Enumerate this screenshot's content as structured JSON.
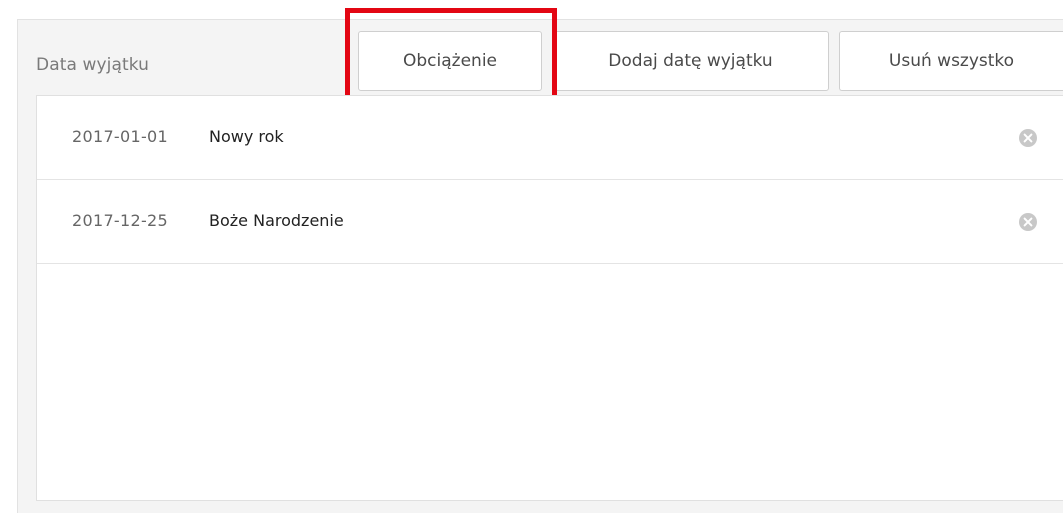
{
  "section": {
    "label": "Data wyjątku"
  },
  "toolbar": {
    "load_label": "Obciążenie",
    "add_label": "Dodaj datę wyjątku",
    "delete_all_label": "Usuń wszystko"
  },
  "exceptions": [
    {
      "date": "2017-01-01",
      "name": "Nowy rok",
      "remove_icon": "remove-circle-icon"
    },
    {
      "date": "2017-12-25",
      "name": "Boże Narodzenie",
      "remove_icon": "remove-circle-icon"
    }
  ],
  "colors": {
    "highlight": "#e30613",
    "panel_bg": "#f4f4f4",
    "remove_icon": "#c8c8c8"
  }
}
